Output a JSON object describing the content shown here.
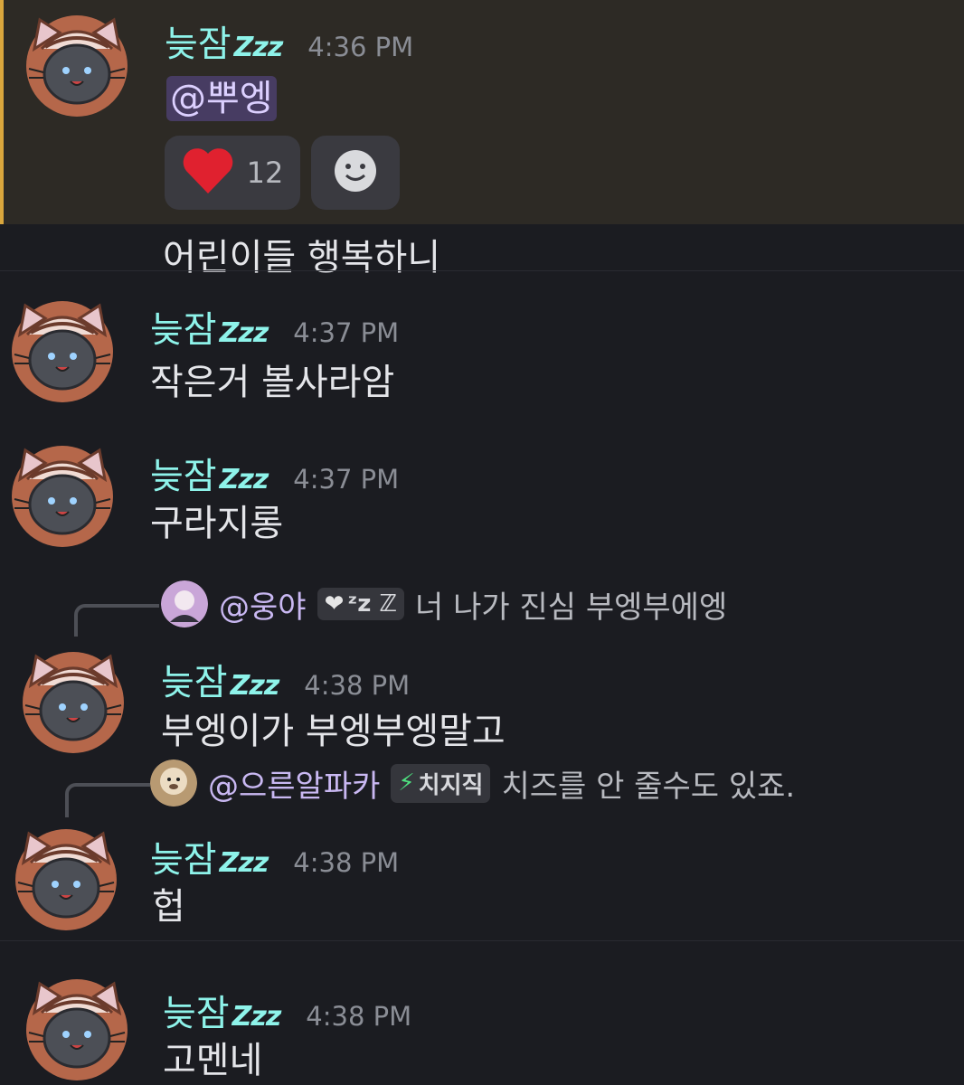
{
  "messages": [
    {
      "username": "늦잠",
      "zzz": "Zzz",
      "time": "4:36 PM",
      "mention": "@뿌엥"
    },
    {
      "text": "어린이들 행복하니"
    },
    {
      "username": "늦잠",
      "zzz": "Zzz",
      "time": "4:37 PM",
      "text": "작은거 볼사라암"
    },
    {
      "username": "늦잠",
      "zzz": "Zzz",
      "time": "4:37 PM",
      "text": "구라지롱"
    },
    {
      "username": "늦잠",
      "zzz": "Zzz",
      "time": "4:38 PM",
      "text": "부엥이가 부엥부엥말고"
    },
    {
      "username": "늦잠",
      "zzz": "Zzz",
      "time": "4:38 PM",
      "text": "헙"
    },
    {
      "username": "늦잠",
      "zzz": "Zzz",
      "time": "4:38 PM",
      "text": "고멘네"
    }
  ],
  "reactions": [
    {
      "emoji": "heart-emoji",
      "count": "12"
    },
    {
      "emoji": "add-reaction-icon"
    }
  ],
  "replies": [
    {
      "name": "@웅야",
      "badge": "ᶻz ℤ",
      "text": "너 나가 진심 부엥부에엥"
    },
    {
      "name": "@으른알파카",
      "badge": "치지직",
      "text": "치즈를 안 줄수도 있죠."
    }
  ],
  "colors": {
    "background": "#1b1c21",
    "highlight": "#2d2a25",
    "highlight_bar": "#d9a63d",
    "username": "#8ef3ea",
    "timestamp": "#8a8d95",
    "mention_bg": "#473c62"
  }
}
